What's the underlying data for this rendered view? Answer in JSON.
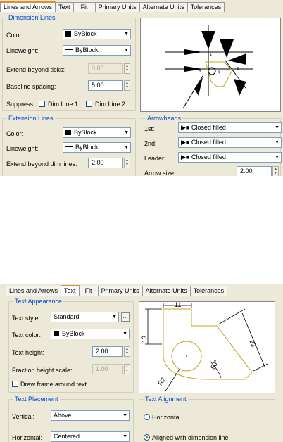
{
  "top": {
    "tabs": [
      "Lines and Arrows",
      "Text",
      "Fit",
      "Primary Units",
      "Alternate Units",
      "Tolerances"
    ],
    "dimension_lines": {
      "title": "Dimension Lines",
      "color_label": "Color:",
      "color_value": "ByBlock",
      "lineweight_label": "Lineweight:",
      "lineweight_value": "ByBlock",
      "extend_label": "Extend beyond ticks:",
      "extend_value": "0.00",
      "baseline_label": "Baseline spacing:",
      "baseline_value": "5.00",
      "suppress_label": "Suppress:",
      "dim_line_1": "Dim Line 1",
      "dim_line_2": "Dim Line 2"
    },
    "extension_lines": {
      "title": "Extension Lines",
      "color_label": "Color:",
      "color_value": "ByBlock",
      "lineweight_label": "Lineweight:",
      "lineweight_value": "ByBlock",
      "extend_label": "Extend beyond dim lines:",
      "extend_value": "2.00"
    },
    "arrowheads": {
      "title": "Arrowheads",
      "first_label": "1st:",
      "first_value": "Closed filled",
      "second_label": "2nd:",
      "second_value": "Closed filled",
      "leader_label": "Leader:",
      "leader_value": "Closed filled",
      "size_label": "Arrow size:",
      "size_value": "2.00"
    }
  },
  "bottom": {
    "tabs": [
      "Lines and Arrows",
      "Text",
      "Fit",
      "Primary Units",
      "Alternate Units",
      "Tolerances"
    ],
    "text_appearance": {
      "title": "Text Appearance",
      "style_label": "Text style:",
      "style_value": "Standard",
      "browse_label": "...",
      "color_label": "Text color:",
      "color_value": "ByBlock",
      "height_label": "Text height:",
      "height_value": "2.00",
      "fraction_label": "Fraction height scale:",
      "fraction_value": "1.00",
      "frame_label": "Draw frame around text"
    },
    "text_placement": {
      "title": "Text Placement",
      "vertical_label": "Vertical:",
      "vertical_value": "Above",
      "horizontal_label": "Horizontal:",
      "horizontal_value": "Centered"
    },
    "text_alignment": {
      "title": "Text Alignment",
      "horizontal": "Horizontal",
      "aligned": "Aligned with dimension line"
    },
    "preview_dims": {
      "d1": "11",
      "d2": "13",
      "d3": "22",
      "d4": "50°",
      "d5": "R2"
    }
  }
}
